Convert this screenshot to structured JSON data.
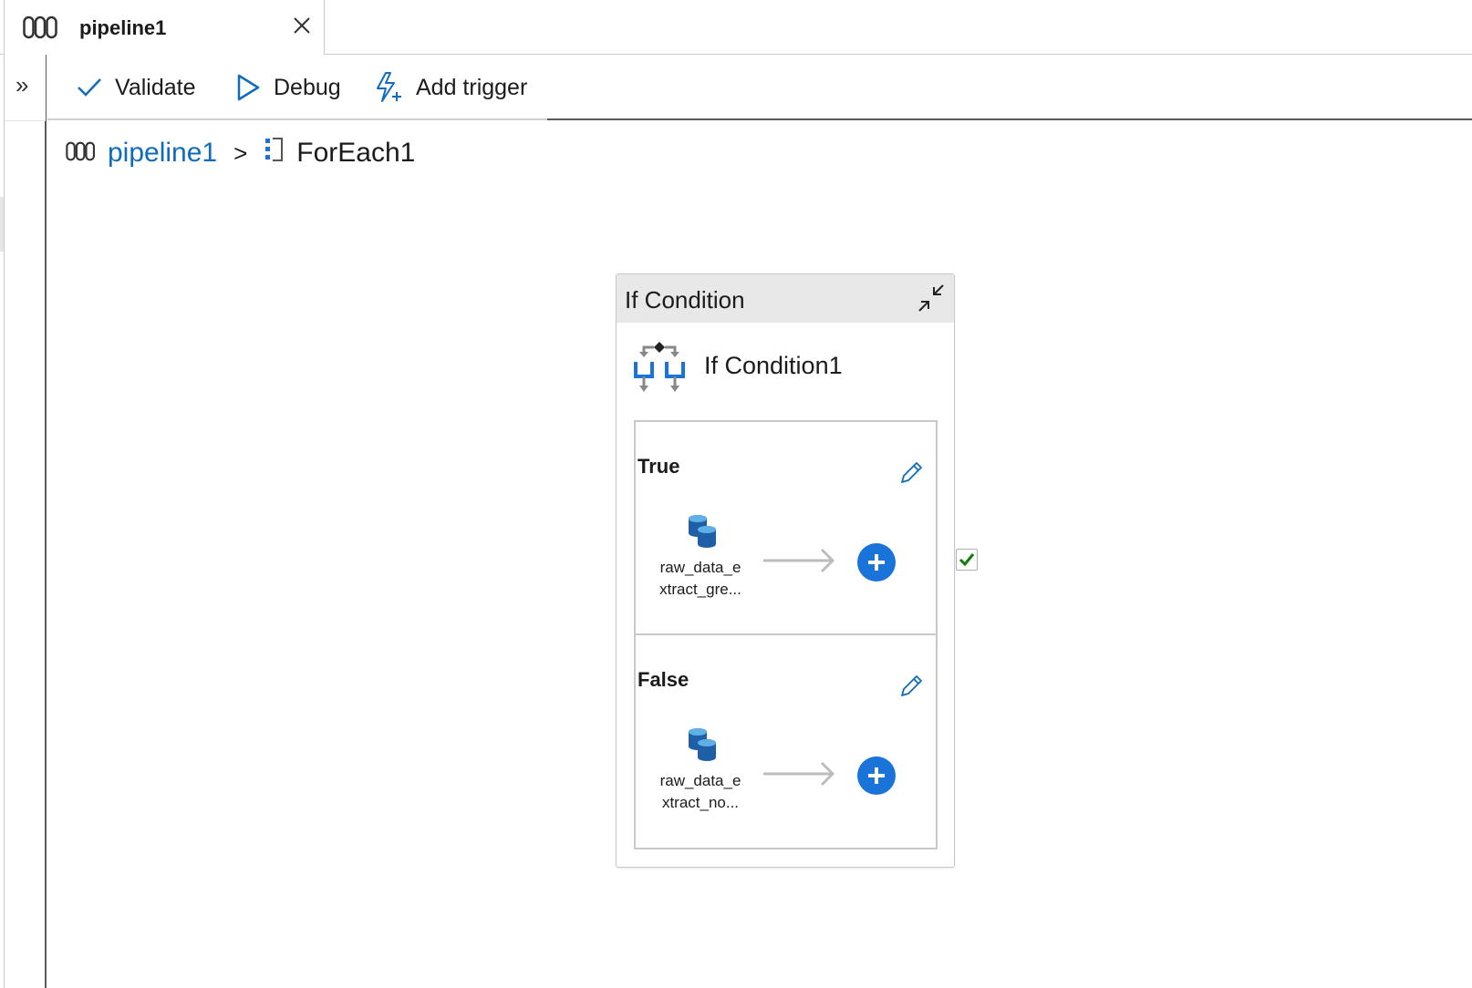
{
  "tab": {
    "label": "pipeline1",
    "icon": "pipeline-icon",
    "close_icon": "close-icon"
  },
  "rail": {
    "expand_label": "»"
  },
  "toolbar": {
    "validate_label": "Validate",
    "debug_label": "Debug",
    "add_trigger_label": "Add trigger"
  },
  "breadcrumb": {
    "pipeline_label": "pipeline1",
    "separator": ">",
    "current_label": "ForEach1"
  },
  "container": {
    "title": "If Condition",
    "activity_name": "If Condition1",
    "branches": [
      {
        "label": "True",
        "activity_name_line1": "raw_data_e",
        "activity_name_line2": "xtract_gre..."
      },
      {
        "label": "False",
        "activity_name_line1": "raw_data_e",
        "activity_name_line2": "xtract_no..."
      }
    ]
  },
  "colors": {
    "accent": "#0f6cbd",
    "add_button": "#1a73d9",
    "success": "#107c10"
  }
}
